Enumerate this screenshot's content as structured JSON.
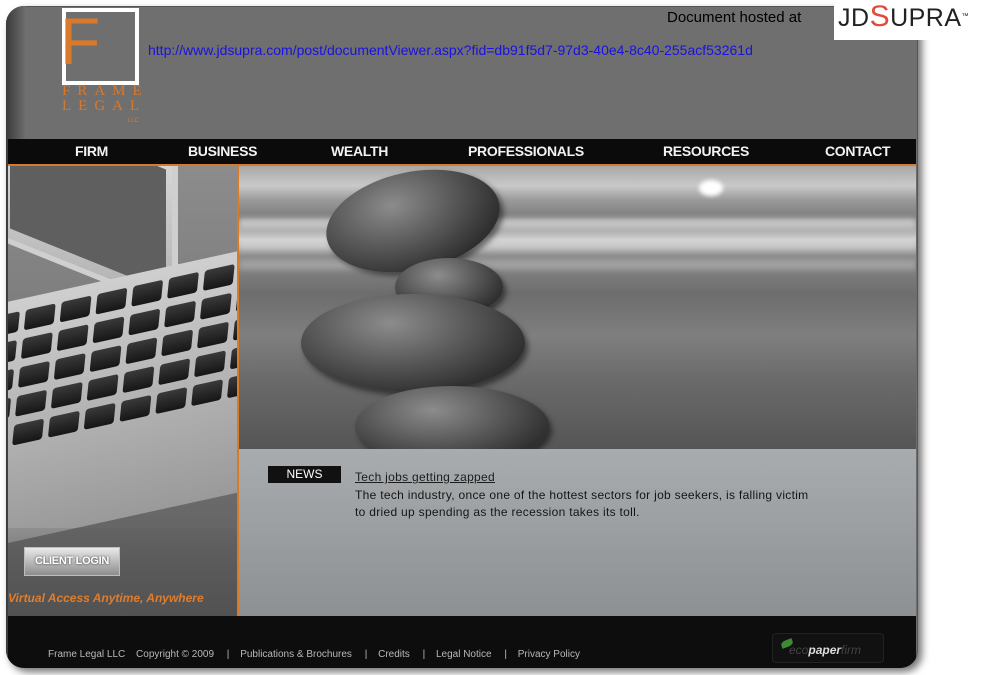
{
  "header": {
    "logo_letter": "F",
    "logo_word": "FRAME LEGAL",
    "logo_suffix": "LLC",
    "hosted_label": "Document hosted at",
    "hosted_brand_prefix": "JD",
    "hosted_brand_s": "S",
    "hosted_brand_suffix": "UPRA",
    "hosted_brand_tm": "™",
    "document_url": "http://www.jdsupra.com/post/documentViewer.aspx?fid=db91f5d7-97d3-40e4-8c40-255acf53261d"
  },
  "nav": {
    "items": [
      "FIRM",
      "BUSINESS",
      "WEALTH",
      "PROFESSIONALS",
      "RESOURCES",
      "CONTACT"
    ]
  },
  "client": {
    "login_label": "CLIENT LOGIN",
    "tagline": "Virtual Access Anytime, Anywhere"
  },
  "news": {
    "badge": "NEWS",
    "title": "Tech jobs getting zapped",
    "body": "The tech industry, once one of the hottest sectors for job seekers, is falling victim to dried up spending as the recession takes its toll."
  },
  "footer": {
    "company": "Frame Legal LLC",
    "copyright": "Copyright © 2009",
    "links": [
      "Publications & Brochures",
      "Credits",
      "Legal Notice",
      "Privacy Policy"
    ],
    "eco_logo_prefix": "eco",
    "eco_logo_main": "paper",
    "eco_logo_suffix": "firm"
  },
  "colors": {
    "accent": "#d8792c",
    "nav_bg": "#0b0b0b",
    "link_blue": "#1a12e0"
  }
}
